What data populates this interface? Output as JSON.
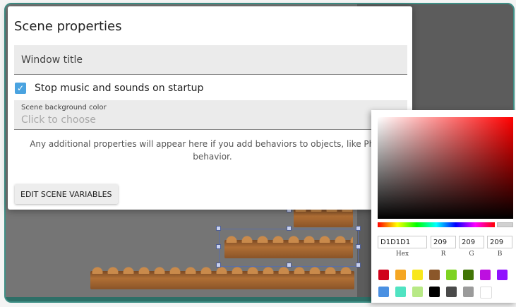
{
  "dialog": {
    "title": "Scene properties",
    "window_title_placeholder": "Window title",
    "stop_music_label": "Stop music and sounds on startup",
    "stop_music_checked": true,
    "bg_color_label": "Scene background color",
    "bg_color_value": "Click to choose",
    "info_text": "Any additional properties will appear here if you add behaviors to objects, like Physics behavior.",
    "edit_vars_label": "EDIT SCENE VARIABLES"
  },
  "color_picker": {
    "hex": "D1D1D1",
    "r": "209",
    "g": "209",
    "b": "209",
    "hex_label": "Hex",
    "r_label": "R",
    "g_label": "G",
    "b_label": "B",
    "presets_row1": [
      "#d0021b",
      "#f5a623",
      "#f8e71c",
      "#8b572a",
      "#7ed321",
      "#417505",
      "#bd10e0",
      "#9013fe"
    ],
    "presets_row2": [
      "#4a90e2",
      "#50e3c2",
      "#b8e986",
      "#000000",
      "#4a4a4a",
      "#9b9b9b",
      "#ffffff"
    ]
  },
  "colors": {
    "accent": "#4aa3e0",
    "editor_bg": "#757575",
    "dialog_bg": "#ffffff"
  }
}
